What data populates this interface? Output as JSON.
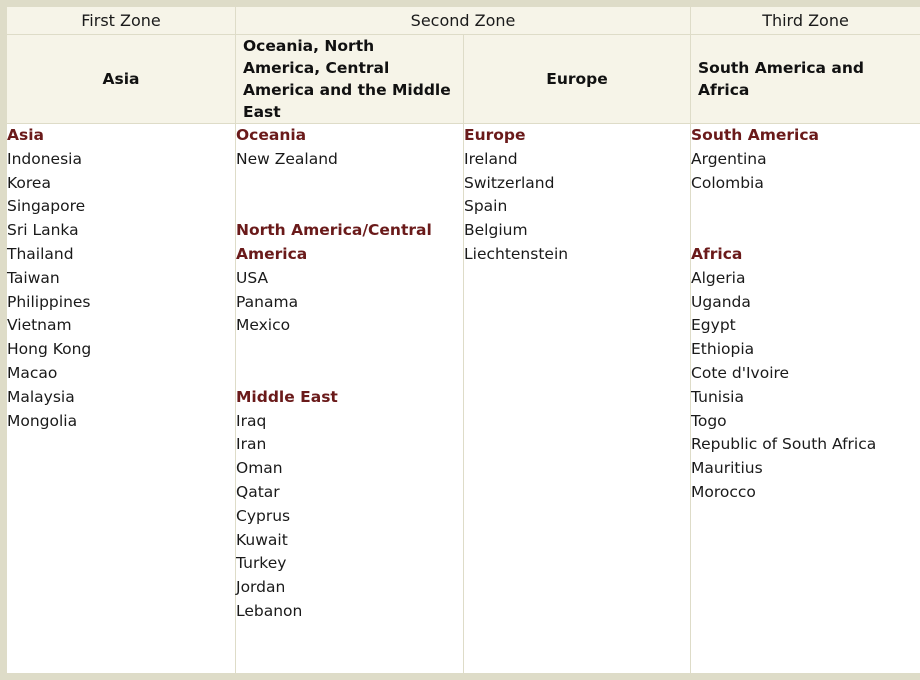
{
  "table": {
    "top_header": [
      {
        "label": "First Zone",
        "colspan": 1
      },
      {
        "label": "Second Zone",
        "colspan": 2
      },
      {
        "label": "Third Zone",
        "colspan": 1
      }
    ],
    "sub_header": [
      {
        "label": "Asia",
        "align": "center"
      },
      {
        "label": "Oceania, North America, Central America and the Middle East",
        "align": "left"
      },
      {
        "label": "Europe",
        "align": "center"
      },
      {
        "label": "South America and Africa",
        "align": "left"
      }
    ],
    "columns": [
      {
        "name": "first-zone-asia",
        "groups": [
          {
            "heading": "Asia",
            "items": [
              "Indonesia",
              "Korea",
              "Singapore",
              "Sri Lanka",
              "Thailand",
              "Taiwan",
              "Philippines",
              "Vietnam",
              "Hong Kong",
              "Macao",
              "Malaysia",
              "Mongolia"
            ]
          }
        ]
      },
      {
        "name": "second-zone-oceania-americas-middle-east",
        "groups": [
          {
            "heading": "Oceania",
            "items": [
              "New Zealand"
            ]
          },
          {
            "heading": "North America/Central America",
            "items": [
              "USA",
              "Panama",
              "Mexico"
            ]
          },
          {
            "heading": "Middle East",
            "items": [
              "Iraq",
              "Iran",
              "Oman",
              "Qatar",
              "Cyprus",
              "Kuwait",
              "Turkey",
              "Jordan",
              "Lebanon"
            ]
          }
        ]
      },
      {
        "name": "second-zone-europe",
        "groups": [
          {
            "heading": "Europe",
            "items": [
              "Ireland",
              "Switzerland",
              "Spain",
              "Belgium",
              "Liechtenstein"
            ]
          }
        ]
      },
      {
        "name": "third-zone-south-america-africa",
        "groups": [
          {
            "heading": "South America",
            "items": [
              "Argentina",
              "Colombia"
            ]
          },
          {
            "heading": "Africa",
            "items": [
              "Algeria",
              "Uganda",
              "Egypt",
              "Ethiopia",
              "Cote d'Ivoire",
              "Tunisia",
              "Togo",
              "Republic of South Africa",
              "Mauritius",
              "Morocco"
            ]
          }
        ]
      }
    ]
  },
  "colors": {
    "border": "#dedcc8",
    "header_background": "#f6f4e8",
    "group_heading": "#6a1a1a",
    "text": "#1a1a1a",
    "cell_background": "#ffffff"
  }
}
